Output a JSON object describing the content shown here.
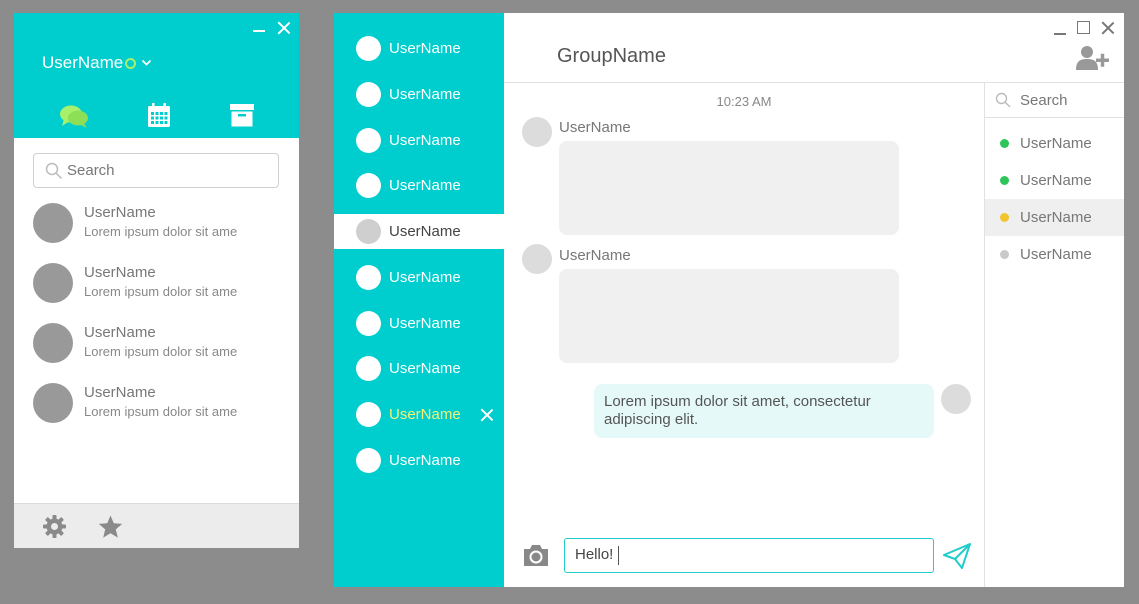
{
  "colors": {
    "accent": "#00cdcd",
    "online": "#2ec45a",
    "away": "#f2c52e",
    "offline": "#c9c9c9",
    "highlight_text": "#f3f277"
  },
  "contacts_window": {
    "user_name": "UserName",
    "tabs": [
      {
        "name": "chats-icon",
        "active": true
      },
      {
        "name": "calendar-icon",
        "active": false
      },
      {
        "name": "archive-icon",
        "active": false
      }
    ],
    "search_placeholder": "Search",
    "contacts": [
      {
        "name": "UserName",
        "preview": "Lorem ipsum dolor sit ame"
      },
      {
        "name": "UserName",
        "preview": "Lorem ipsum dolor sit ame"
      },
      {
        "name": "UserName",
        "preview": "Lorem ipsum dolor sit ame"
      },
      {
        "name": "UserName",
        "preview": "Lorem ipsum dolor sit ame"
      }
    ],
    "footer_icons": [
      "gear-icon",
      "star-icon"
    ]
  },
  "chat_window": {
    "groups": [
      {
        "label": "UserName"
      },
      {
        "label": "UserName"
      },
      {
        "label": "UserName"
      },
      {
        "label": "UserName"
      },
      {
        "label": "UserName",
        "selected": true
      },
      {
        "label": "UserName"
      },
      {
        "label": "UserName"
      },
      {
        "label": "UserName"
      },
      {
        "label": "UserName",
        "highlighted": true
      },
      {
        "label": "UserName"
      }
    ],
    "group_title": "GroupName",
    "timestamp": "10:23 AM",
    "messages": [
      {
        "sender": "UserName",
        "direction": "in"
      },
      {
        "sender": "UserName",
        "direction": "in"
      },
      {
        "direction": "out",
        "text": "Lorem ipsum dolor sit amet, consectetur adipiscing elit."
      }
    ],
    "compose_value": "Hello!",
    "members_search_placeholder": "Search",
    "members": [
      {
        "name": "UserName",
        "status": "online"
      },
      {
        "name": "UserName",
        "status": "online"
      },
      {
        "name": "UserName",
        "status": "away",
        "selected": true
      },
      {
        "name": "UserName",
        "status": "offline"
      }
    ]
  }
}
